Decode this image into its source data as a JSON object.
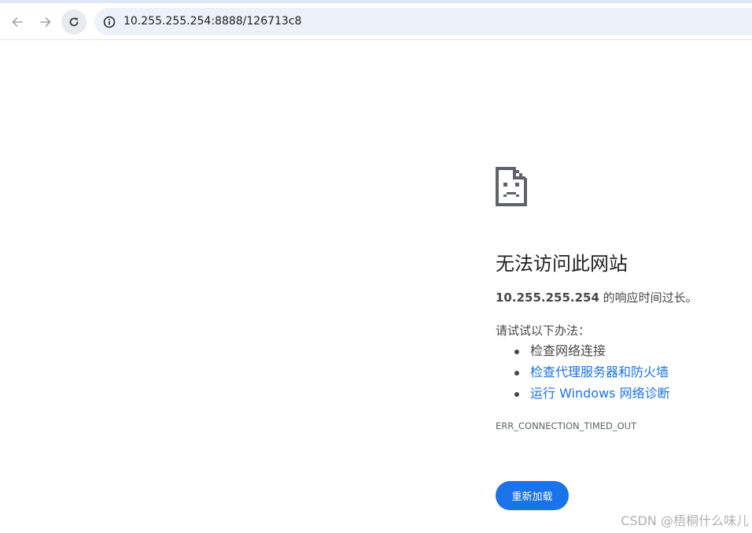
{
  "browser": {
    "url": "10.255.255.254:8888/126713c8",
    "icons": {
      "back": "arrow-left-icon",
      "forward": "arrow-right-icon",
      "reload": "reload-icon",
      "site_info": "info-icon"
    },
    "accent_color": "#dfe7f5",
    "omnibox_color": "#edf2fa"
  },
  "error_page": {
    "icon": "sad-document-icon",
    "title": "无法访问此网站",
    "host": "10.255.255.254",
    "desc_suffix": " 的响应时间过长。",
    "try_label": "请试试以下办法：",
    "suggestions": [
      "检查网络连接",
      "检查代理服务器和防火墙",
      "运行 Windows 网络诊断"
    ],
    "error_code": "ERR_CONNECTION_TIMED_OUT",
    "reload_button": "重新加载",
    "link_color": "#1a73e8"
  },
  "watermark": "CSDN @梧桐什么味儿"
}
